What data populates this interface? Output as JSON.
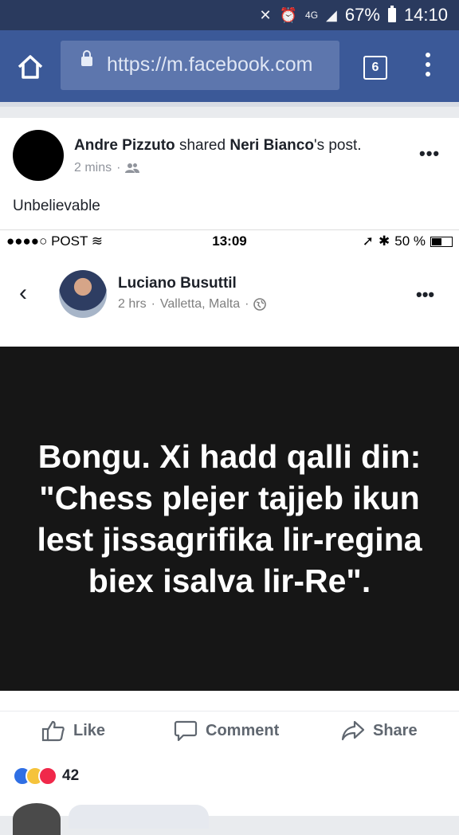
{
  "status_bar": {
    "battery": "67%",
    "time": "14:10",
    "network": "4G"
  },
  "browser": {
    "url": "https://m.facebook.com",
    "tab_count": "6"
  },
  "post": {
    "author": "Andre Pizzuto",
    "verb": "shared",
    "shared_from": "Neri Bianco",
    "shared_suffix": "'s post.",
    "time": "2 mins",
    "dot": "·",
    "text": "Unbelievable"
  },
  "inner_status": {
    "carrier": "●●●●○ POST",
    "time": "13:09",
    "battery": "50 %"
  },
  "inner_post": {
    "author": "Luciano Busuttil",
    "time": "2 hrs",
    "dot1": "·",
    "location": "Valletta, Malta",
    "dot2": "·",
    "quote": "Bongu. Xi hadd qalli din: \"Chess plejer tajjeb ikun lest jissagrifika lir-regina biex isalva lir-Re\"."
  },
  "actions": {
    "like": "Like",
    "comment": "Comment",
    "share": "Share"
  },
  "reaction_count": "42",
  "colors": {
    "brand": "#3b5998",
    "status_bar": "#2a3a5e"
  }
}
